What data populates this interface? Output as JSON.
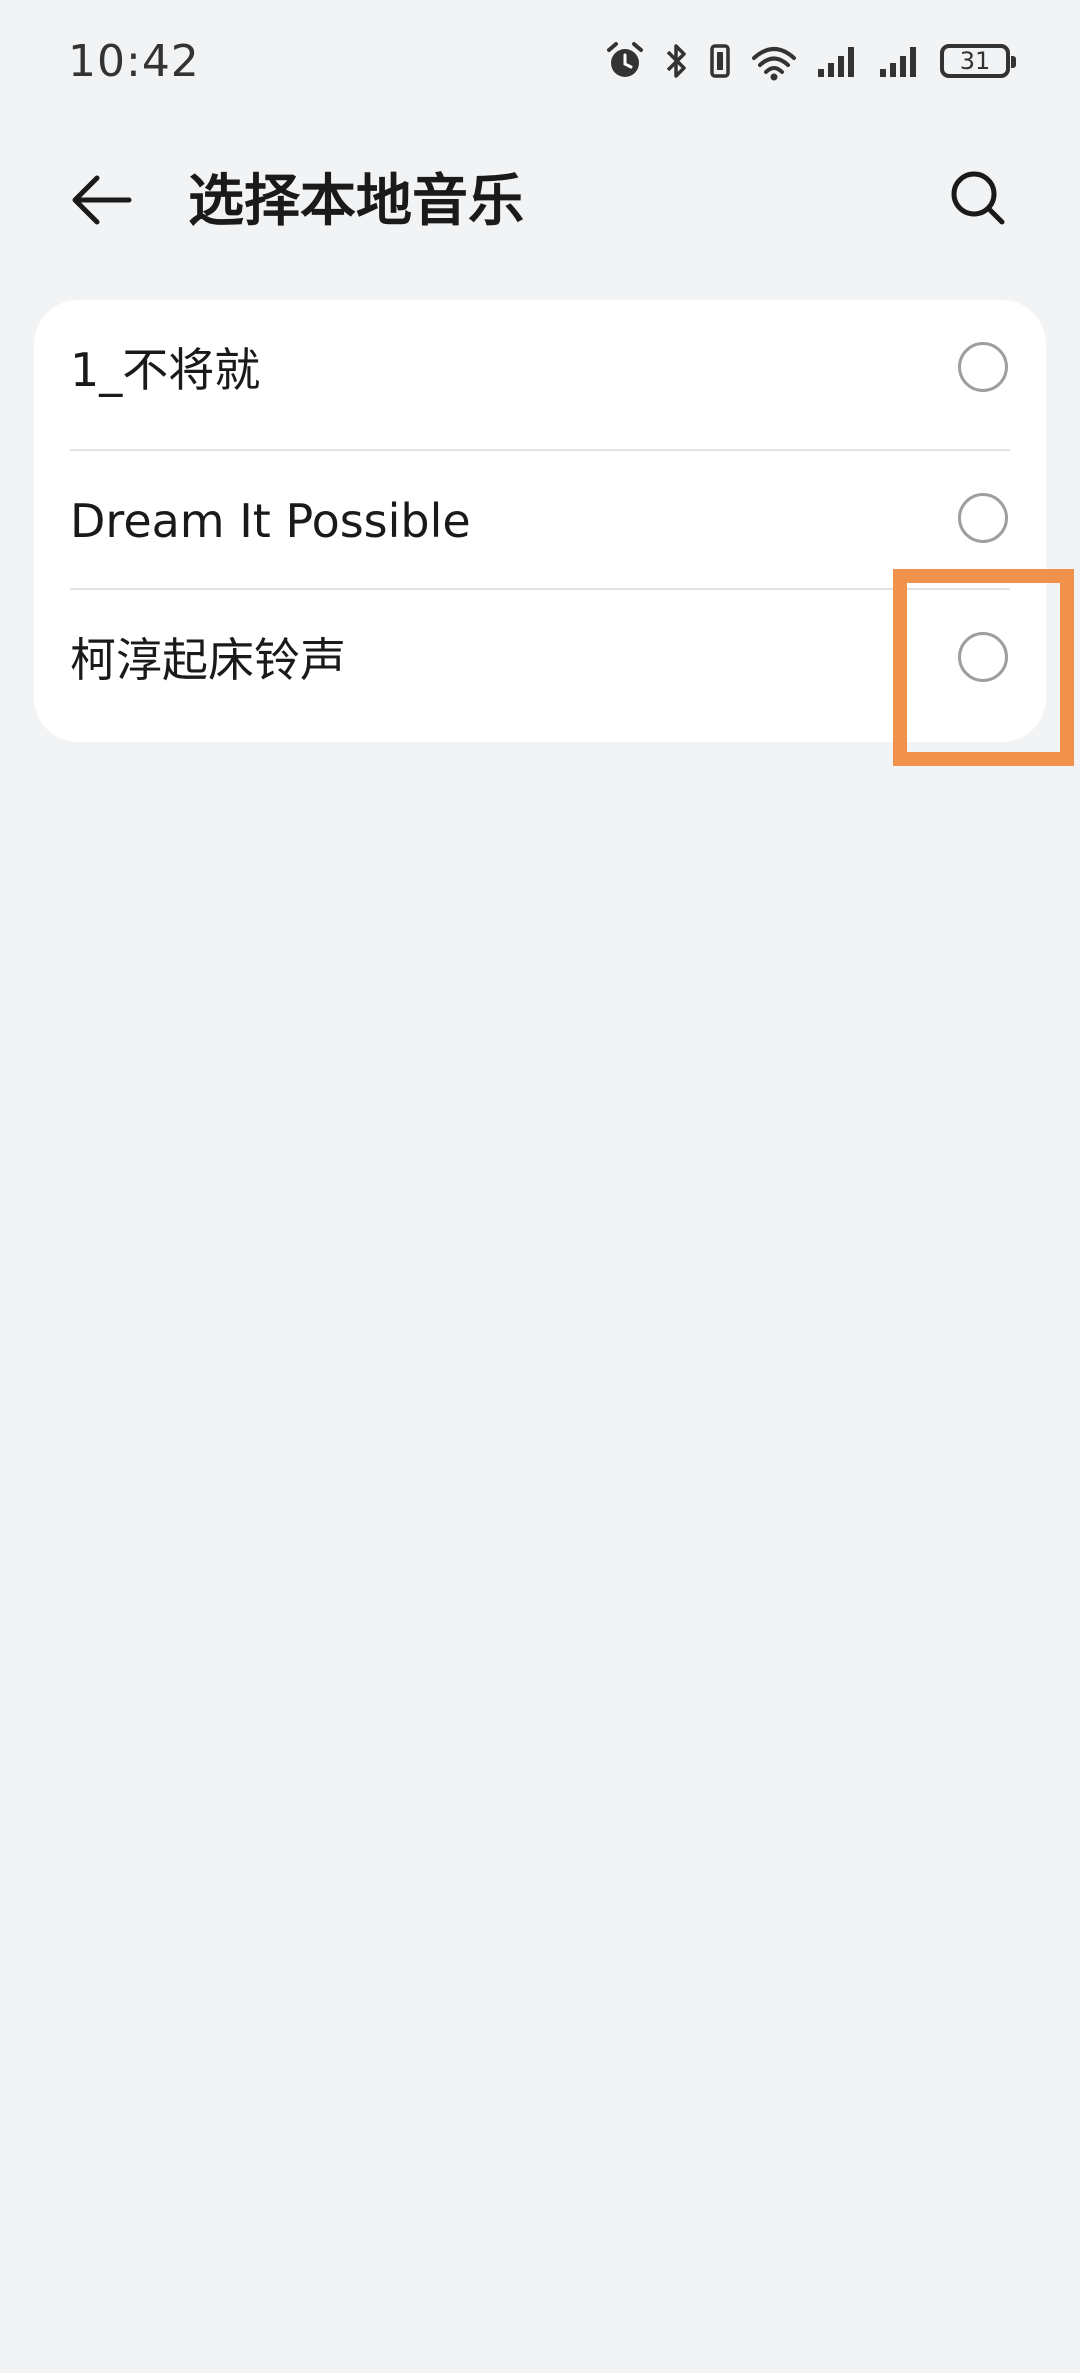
{
  "status_bar": {
    "time": "10:42",
    "battery_level": "31",
    "icons": [
      "alarm-icon",
      "bluetooth-icon",
      "vibrate-icon",
      "wifi-icon",
      "signal-icon-1",
      "signal-icon-2",
      "battery-icon"
    ]
  },
  "header": {
    "title": "选择本地音乐",
    "back_icon": "back-arrow-icon",
    "search_icon": "search-icon"
  },
  "music_list": {
    "items": [
      {
        "label": "1_不将就",
        "selected": false
      },
      {
        "label": "Dream It Possible",
        "selected": false
      },
      {
        "label": "柯淳起床铃声",
        "selected": false
      }
    ]
  },
  "colors": {
    "background": "#f1f3f5",
    "card": "#ffffff",
    "highlight": "#f0924b",
    "radio_border": "#9e9e9e"
  }
}
